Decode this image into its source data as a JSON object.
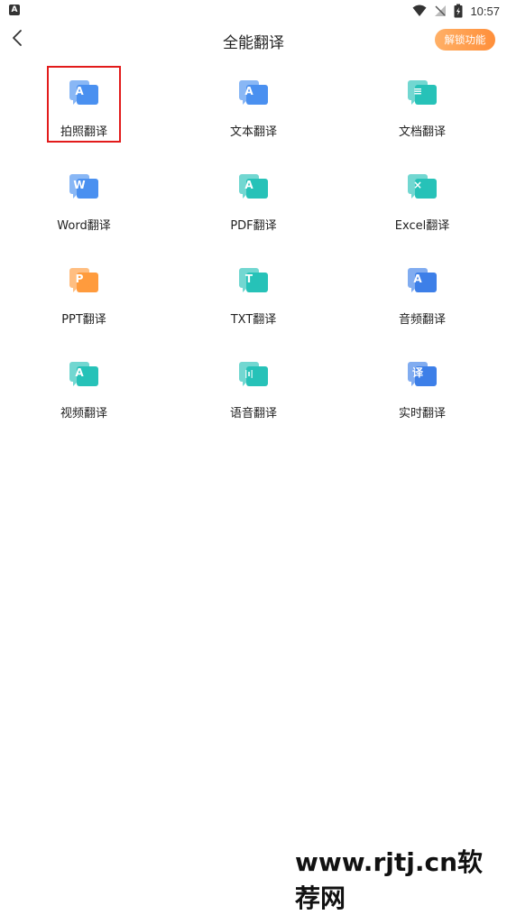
{
  "status_bar": {
    "time": "10:57",
    "app_icon_letter": "A"
  },
  "header": {
    "back_icon": "back-arrow-icon",
    "title": "全能翻译",
    "unlock_label": "解锁功能"
  },
  "features": [
    {
      "label": "拍照翻译",
      "icon": "photo-translate-icon",
      "glyph": "A",
      "color": "#4a90f0"
    },
    {
      "label": "文本翻译",
      "icon": "text-translate-icon",
      "glyph": "A",
      "color": "#4a90f0"
    },
    {
      "label": "文档翻译",
      "icon": "document-translate-icon",
      "glyph": "≡",
      "color": "#27c2b8"
    },
    {
      "label": "Word翻译",
      "icon": "word-translate-icon",
      "glyph": "W",
      "color": "#4a90f0"
    },
    {
      "label": "PDF翻译",
      "icon": "pdf-translate-icon",
      "glyph": "A",
      "color": "#27c2b8"
    },
    {
      "label": "Excel翻译",
      "icon": "excel-translate-icon",
      "glyph": "×",
      "color": "#27c2b8"
    },
    {
      "label": "PPT翻译",
      "icon": "ppt-translate-icon",
      "glyph": "P",
      "color": "#ff9b3d"
    },
    {
      "label": "TXT翻译",
      "icon": "txt-translate-icon",
      "glyph": "T",
      "color": "#27c2b8"
    },
    {
      "label": "音频翻译",
      "icon": "audio-translate-icon",
      "glyph": "A",
      "color": "#3d7fe8"
    },
    {
      "label": "视频翻译",
      "icon": "video-translate-icon",
      "glyph": "A",
      "color": "#27c2b8"
    },
    {
      "label": "语音翻译",
      "icon": "voice-translate-icon",
      "glyph": "|ı|",
      "color": "#27c2b8"
    },
    {
      "label": "实时翻译",
      "icon": "realtime-translate-icon",
      "glyph": "译",
      "color": "#3d7fe8"
    }
  ],
  "highlight_color": "#e21b1b",
  "watermark": "www.rjtj.cn软荐网"
}
